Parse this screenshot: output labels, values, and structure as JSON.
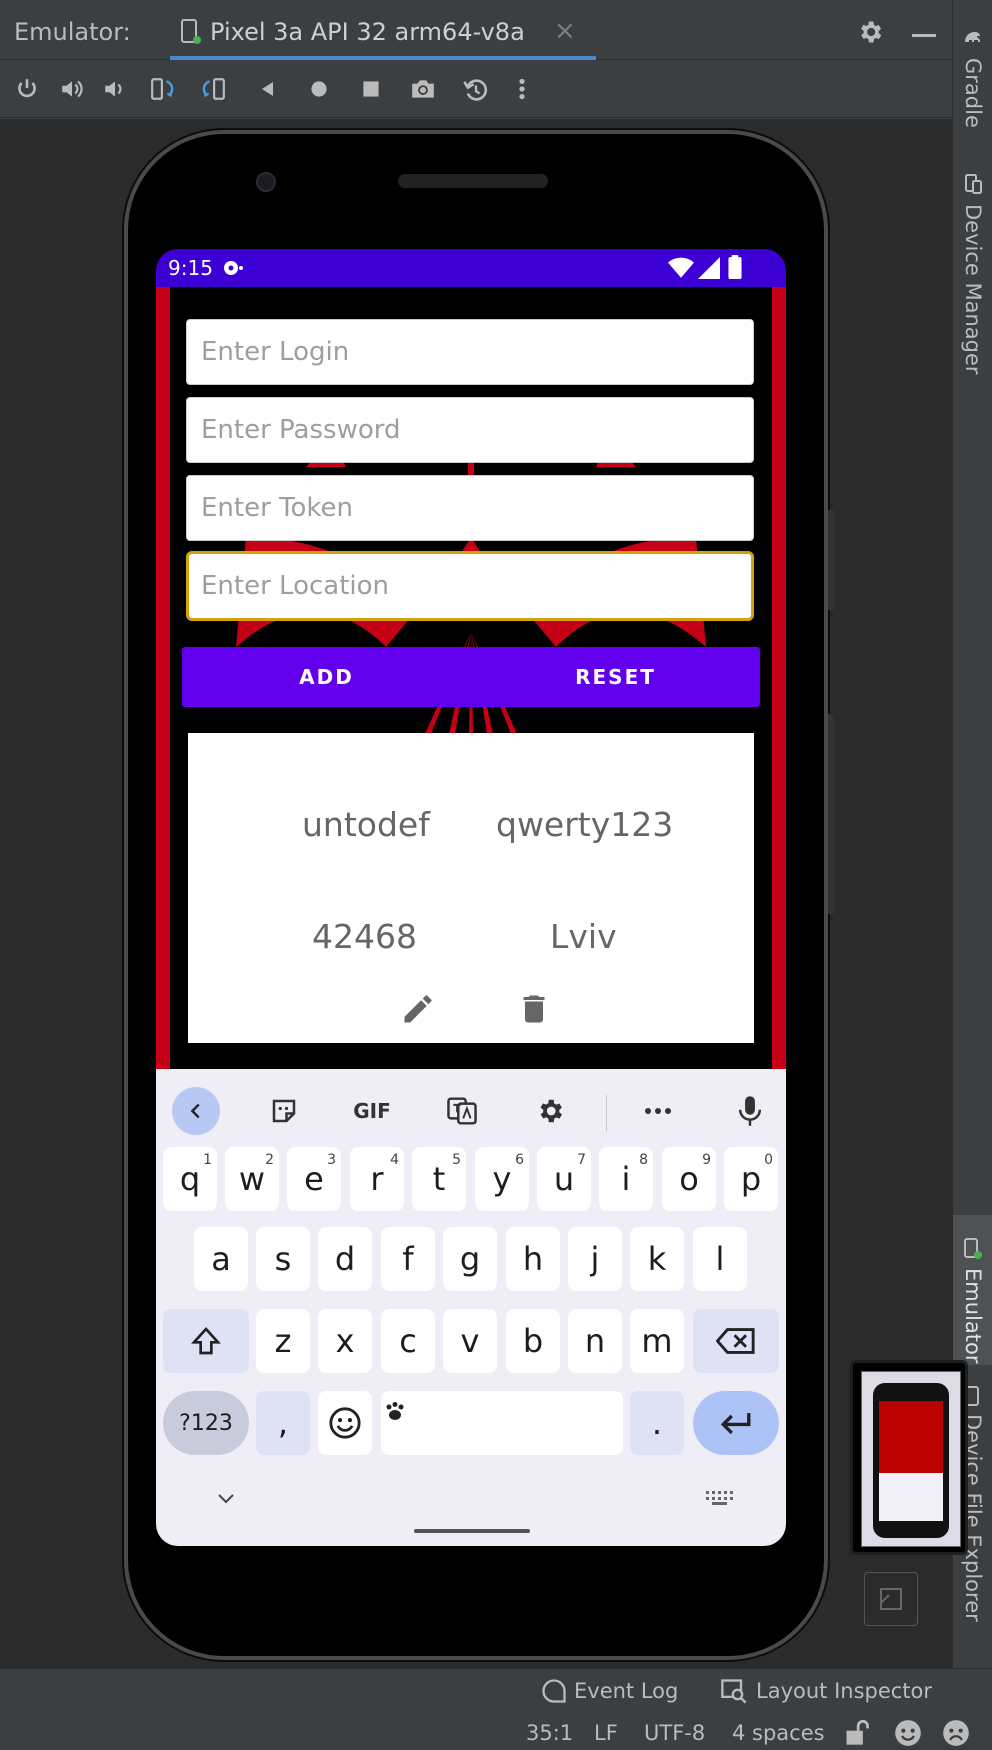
{
  "ide": {
    "emulator_label": "Emulator:",
    "device_tab": "Pixel 3a API 32 arm64-v8a",
    "close_glyph": "×",
    "right_tabs": [
      "Gradle",
      "Device Manager",
      "Emulator",
      "Device File Explorer"
    ],
    "statusbar": {
      "event_log": "Event Log",
      "layout_inspector": "Layout Inspector",
      "position": "35:1",
      "line_sep": "LF",
      "encoding": "UTF-8",
      "indent": "4 spaces"
    }
  },
  "phone": {
    "status_time": "9:15",
    "fields": [
      {
        "placeholder": "Enter Login"
      },
      {
        "placeholder": "Enter Password"
      },
      {
        "placeholder": "Enter Token"
      },
      {
        "placeholder": "Enter Location"
      }
    ],
    "buttons": {
      "add": "ADD",
      "reset": "RESET"
    },
    "record": {
      "login": "untodef",
      "password": "qwerty123",
      "token": "42468",
      "location": "Lviv"
    }
  },
  "keyboard": {
    "tools": {
      "gif": "GIF"
    },
    "row1": [
      {
        "k": "q",
        "n": "1"
      },
      {
        "k": "w",
        "n": "2"
      },
      {
        "k": "e",
        "n": "3"
      },
      {
        "k": "r",
        "n": "4"
      },
      {
        "k": "t",
        "n": "5"
      },
      {
        "k": "y",
        "n": "6"
      },
      {
        "k": "u",
        "n": "7"
      },
      {
        "k": "i",
        "n": "8"
      },
      {
        "k": "o",
        "n": "9"
      },
      {
        "k": "p",
        "n": "0"
      }
    ],
    "row2": [
      "a",
      "s",
      "d",
      "f",
      "g",
      "h",
      "j",
      "k",
      "l"
    ],
    "row3": [
      "z",
      "x",
      "c",
      "v",
      "b",
      "n",
      "m"
    ],
    "bottom": {
      "symbols": "?123",
      "comma": ",",
      "period": "."
    }
  },
  "colors": {
    "status_bar": "#3c00d4",
    "primary_button": "#6200ee",
    "focus_border": "#d4a20d",
    "app_background_red": "#c30016",
    "ide_accent": "#4a88c7"
  }
}
